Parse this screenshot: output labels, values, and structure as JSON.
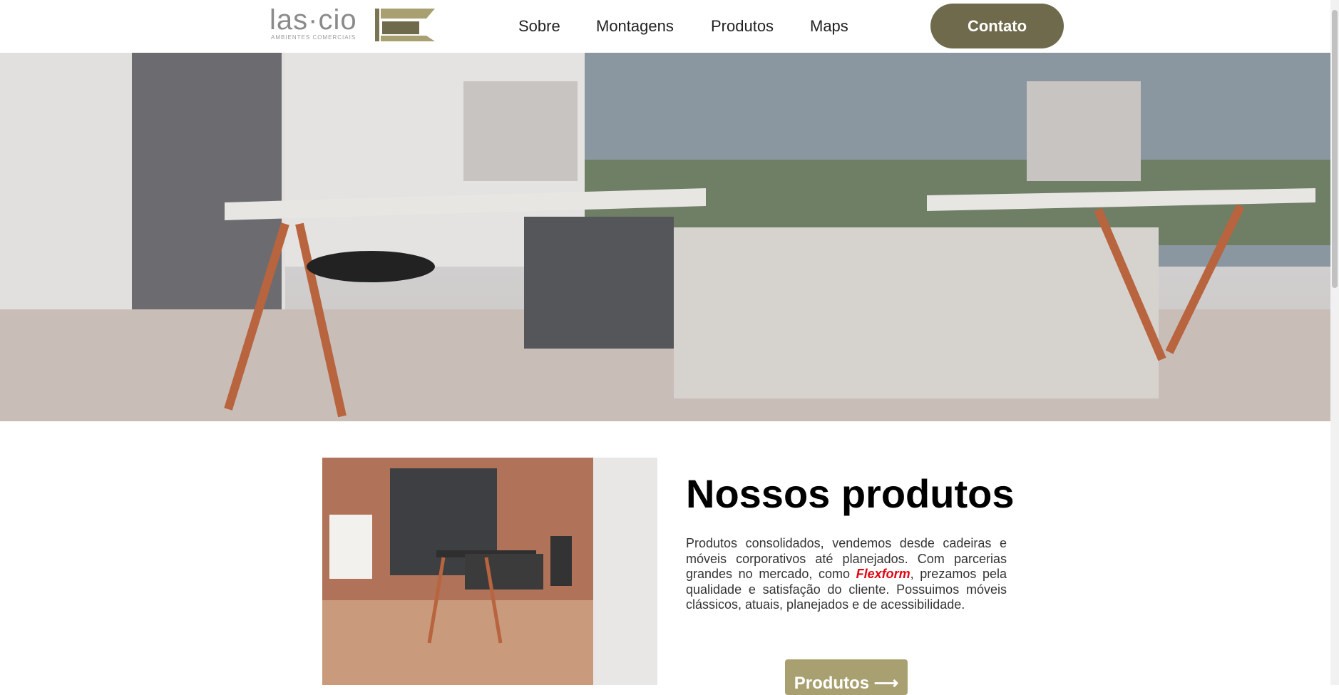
{
  "header": {
    "logo": "las·cio",
    "logo_sub": "AMBIENTES COMERCIAIS",
    "nav": [
      "Sobre",
      "Montagens",
      "Produtos",
      "Maps"
    ],
    "contact_label": "Contato",
    "accent": "#6f6a4b"
  },
  "products": {
    "title": "Nossos produtos",
    "text_before": "Produtos consolidados, vendemos desde cadeiras e móveis corporativos até planejados. Com parcerias grandes no mercado, como ",
    "brand": "Flexform",
    "text_after": ", prezamos pela qualidade e satisfação do cliente. Possuimos móveis clássicos, atuais, planejados e de acessibilidade.",
    "button_label": "Produtos ⟶",
    "button_color": "#a8a070"
  }
}
